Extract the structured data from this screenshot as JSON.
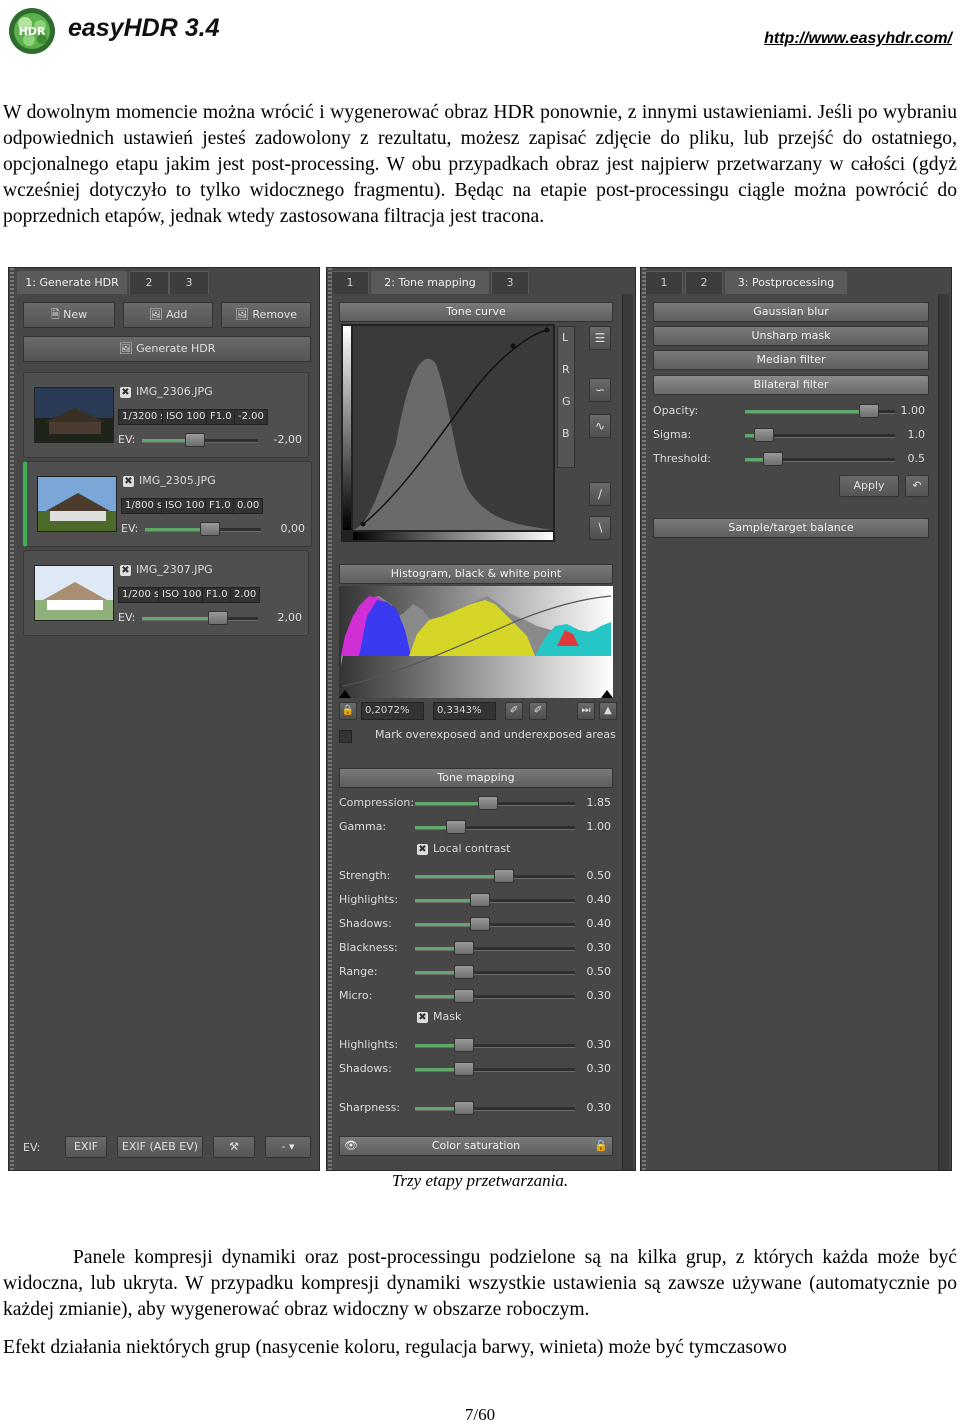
{
  "header": {
    "app_title": "easyHDR 3.4",
    "url": "http://www.easyhdr.com/"
  },
  "intro_paragraph": "W dowolnym momencie można wrócić i wygenerować obraz HDR ponownie, z innymi ustawieniami. Jeśli po wybraniu odpowiednich ustawień jesteś zadowolony z rezultatu, możesz zapisać zdjęcie do pliku, lub przejść do ostatniego, opcjonalnego etapu jakim jest post-processing. W obu przypadkach obraz jest najpierw przetwarzany w całości (gdyż wcześniej dotyczyło to tylko widocznego fragmentu). Będąc na etapie post-processingu ciągle można powrócić do poprzednich etapów, jednak wtedy zastosowana filtracja jest tracona.",
  "panel1": {
    "tabs": [
      "1: Generate HDR",
      "2",
      "3"
    ],
    "buttons": {
      "new": "New",
      "add": "Add",
      "remove": "Remove",
      "generate": "Generate HDR"
    },
    "images": [
      {
        "name": "IMG_2306.JPG",
        "shutter": "1/3200 s",
        "iso": "ISO 100",
        "aperture": "F1.0",
        "ev_offset": "-2.00",
        "ev_label": "EV:",
        "ev_value": "-2,00",
        "slider": 0.45
      },
      {
        "name": "IMG_2305.JPG",
        "shutter": "1/800 s",
        "iso": "ISO 100",
        "aperture": "F1.0",
        "ev_offset": "0.00",
        "ev_label": "EV:",
        "ev_value": "0,00",
        "slider": 0.55
      },
      {
        "name": "IMG_2307.JPG",
        "shutter": "1/200 s",
        "iso": "ISO 100",
        "aperture": "F1.0",
        "ev_offset": "2.00",
        "ev_label": "EV:",
        "ev_value": "2,00",
        "slider": 0.65
      }
    ],
    "bottom": {
      "ev_label": "EV:",
      "exif": "EXIF",
      "exif_aeb": "EXIF (AEB EV)",
      "dropdown": "-"
    }
  },
  "panel2": {
    "tabs": [
      "1",
      "2: Tone mapping",
      "3"
    ],
    "tone_curve_title": "Tone curve",
    "channels": [
      "L",
      "R",
      "G",
      "B"
    ],
    "histogram_title": "Histogram, black & white point",
    "black_point": "0,2072%",
    "white_point": "0,3343%",
    "mark_label": "Mark overexposed and underexposed areas",
    "tone_mapping_title": "Tone mapping",
    "sliders": [
      {
        "label": "Compression:",
        "value": "1.85",
        "pos": 0.45
      },
      {
        "label": "Gamma:",
        "value": "1.00",
        "pos": 0.25
      },
      {
        "label": "Strength:",
        "value": "0.50",
        "pos": 0.55
      },
      {
        "label": "Highlights:",
        "value": "0.40",
        "pos": 0.4
      },
      {
        "label": "Shadows:",
        "value": "0.40",
        "pos": 0.4
      },
      {
        "label": "Blackness:",
        "value": "0.30",
        "pos": 0.3
      },
      {
        "label": "Range:",
        "value": "0.50",
        "pos": 0.3
      },
      {
        "label": "Micro:",
        "value": "0.30",
        "pos": 0.3
      },
      {
        "label": "Highlights:",
        "value": "0.30",
        "pos": 0.3
      },
      {
        "label": "Shadows:",
        "value": "0.30",
        "pos": 0.3
      },
      {
        "label": "Sharpness:",
        "value": "0.30",
        "pos": 0.3
      }
    ],
    "local_contrast": "Local contrast",
    "mask": "Mask",
    "color_saturation": "Color saturation"
  },
  "panel3": {
    "tabs": [
      "1",
      "2",
      "3: Postprocessing"
    ],
    "filters": [
      "Gaussian blur",
      "Unsharp mask",
      "Median filter",
      "Bilateral filter"
    ],
    "sliders": [
      {
        "label": "Opacity:",
        "value": "1.00",
        "pos": 0.82
      },
      {
        "label": "Sigma:",
        "value": "1.0",
        "pos": 0.12
      },
      {
        "label": "Threshold:",
        "value": "0.5",
        "pos": 0.18
      }
    ],
    "apply": "Apply",
    "sample_balance": "Sample/target balance"
  },
  "caption": "Trzy etapy przetwarzania.",
  "paragraph2": "Panele kompresji dynamiki oraz post-processingu podzielone są na kilka grup, z których każda może być widoczna, lub ukryta. W przypadku kompresji dynamiki wszystkie ustawienia są zawsze używane (automatycznie po każdej zmianie), aby wygenerować obraz widoczny w obszarze roboczym.",
  "paragraph3": "Efekt działania niektórych grup (nasycenie koloru, regulacja barwy, winieta) może być tymczasowo",
  "footer": {
    "page": "7/60"
  }
}
